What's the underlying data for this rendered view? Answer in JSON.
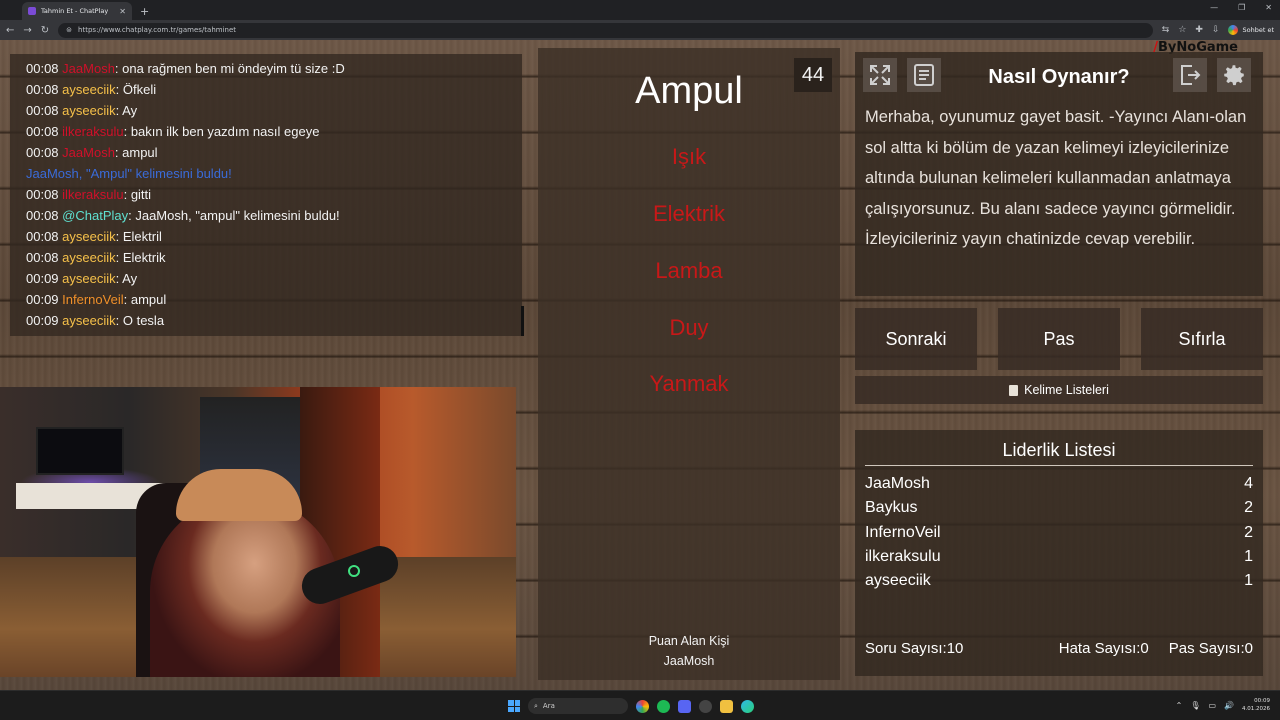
{
  "browser": {
    "tab_title": "Tahmin Et - ChatPlay",
    "url": "https://www.chatplay.com.tr/games/tahminet",
    "profile_label": "Sohbet et"
  },
  "logo": {
    "slash": "/",
    "text": "ByNoGame"
  },
  "chat": {
    "messages": [
      {
        "time": "00:08",
        "user": "JaaMosh",
        "user_color": "#d0102a",
        "text": ": ona rağmen ben mi öndeyim tü size :D"
      },
      {
        "time": "00:08",
        "user": "ayseeciik",
        "user_color": "#f5c04a",
        "text": ": Öfkeli"
      },
      {
        "time": "00:08",
        "user": "ayseeciik",
        "user_color": "#f5c04a",
        "text": ": Ay"
      },
      {
        "time": "00:08",
        "user": "ilkeraksulu",
        "user_color": "#d0102a",
        "text": ": bakın ilk ben yazdım nasıl egeye"
      },
      {
        "time": "00:08",
        "user": "JaaMosh",
        "user_color": "#d0102a",
        "text": ": ampul"
      },
      {
        "time": "",
        "user": "JaaMosh, \"Ampul\" kelimesini buldu!",
        "user_color": "#3a6bd8",
        "text": ""
      },
      {
        "time": "00:08",
        "user": "ilkeraksulu",
        "user_color": "#d0102a",
        "text": ": gitti"
      },
      {
        "time": "00:08",
        "user": "@ChatPlay",
        "user_color": "#5fe0d0",
        "text": ": JaaMosh, \"ampul\" kelimesini buldu!"
      },
      {
        "time": "00:08",
        "user": "ayseeciik",
        "user_color": "#f5c04a",
        "text": ": Elektril"
      },
      {
        "time": "00:08",
        "user": "ayseeciik",
        "user_color": "#f5c04a",
        "text": ": Elektrik"
      },
      {
        "time": "00:09",
        "user": "ayseeciik",
        "user_color": "#f5c04a",
        "text": ": Ay"
      },
      {
        "time": "00:09",
        "user": "InfernoVeil",
        "user_color": "#f0902a",
        "text": ": ampul"
      },
      {
        "time": "00:09",
        "user": "ayseeciik",
        "user_color": "#f5c04a",
        "text": ": O tesla"
      }
    ]
  },
  "game": {
    "timer": "44",
    "word": "Ampul",
    "taboo_words": [
      "Işık",
      "Elektrik",
      "Lamba",
      "Duy",
      "Yanmak"
    ],
    "taboo_color": "#c81818",
    "scorer_label": "Puan Alan Kişi",
    "scorer_name": "JaaMosh"
  },
  "how_to_play": {
    "title": "Nasıl Oynanır?",
    "text": "Merhaba, oyunumuz gayet basit. -Yayıncı Alanı-olan sol altta ki bölüm de yazan kelimeyi izleyicilerinize altında bulunan kelimeleri kullanmadan anlatmaya çalışıyorsunuz. Bu alanı sadece yayıncı görmelidir. İzleyicileriniz yayın chatinizde cevap verebilir.",
    "icons": [
      "fullscreen-icon",
      "notes-icon",
      "exit-icon",
      "gear-icon"
    ]
  },
  "buttons": {
    "next": "Sonraki",
    "pass": "Pas",
    "reset": "Sıfırla",
    "word_lists": "Kelime Listeleri"
  },
  "leaderboard": {
    "title": "Liderlik Listesi",
    "rows": [
      {
        "name": "JaaMosh",
        "score": "4"
      },
      {
        "name": "Baykus",
        "score": "2"
      },
      {
        "name": "InfernoVeil",
        "score": "2"
      },
      {
        "name": "ilkeraksulu",
        "score": "1"
      },
      {
        "name": "ayseeciik",
        "score": "1"
      }
    ],
    "question_count": "Soru Sayısı:10",
    "error_count": "Hata Sayısı:0",
    "pass_count": "Pas Sayısı:0"
  },
  "taskbar": {
    "search_placeholder": "Ara",
    "time": "00:09",
    "date": "4.01.2026"
  }
}
